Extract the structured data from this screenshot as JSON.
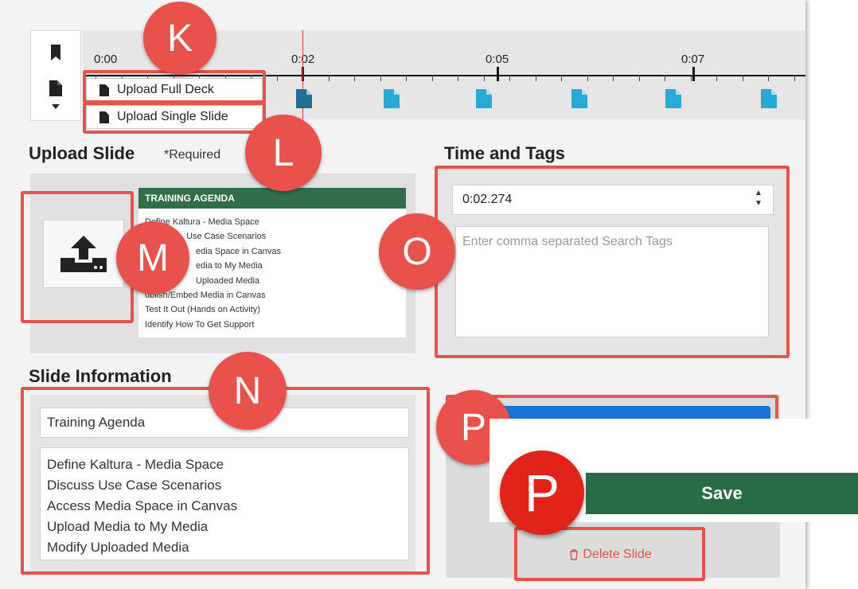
{
  "timeline": {
    "time_labels": [
      "0:00",
      "0:02",
      "0:05",
      "0:07"
    ]
  },
  "upload_menu": {
    "full_deck": "Upload Full Deck",
    "single_slide": "Upload Single Slide"
  },
  "upload_slide": {
    "heading": "Upload Slide",
    "required": "*Required",
    "thumbnail": {
      "title": "TRAINING AGENDA",
      "items": [
        "Define Kaltura - Media Space",
        "Use Case Scenarios",
        "edia Space in Canvas",
        "edia to My Media",
        "Uploaded Media",
        "ublish/Embed Media in Canvas",
        "Test It Out (Hands on Activity)",
        "Identify How To Get Support"
      ]
    }
  },
  "time_tags": {
    "heading": "Time and Tags",
    "time_value": "0:02.274",
    "tags_placeholder": "Enter comma separated Search Tags"
  },
  "slide_info": {
    "heading": "Slide Information",
    "title_value": "Training Agenda",
    "body_lines": [
      "Define Kaltura - Media Space",
      "Discuss Use Case Scenarios",
      "Access Media Space in Canvas",
      "Upload Media to My Media",
      "Modify Uploaded Media"
    ]
  },
  "actions": {
    "save": "Save",
    "delete": "Delete Slide"
  },
  "badges": {
    "k": "K",
    "l": "L",
    "m": "M",
    "n": "N",
    "o": "O",
    "p": "P",
    "p_zoom": "P"
  },
  "colors": {
    "annotation_red": "#e8524a",
    "save_green": "#276b47",
    "thumb_header_green": "#2f6e49",
    "blue_button": "#1a73d9",
    "slide_marker_teal": "#29a9d6"
  }
}
